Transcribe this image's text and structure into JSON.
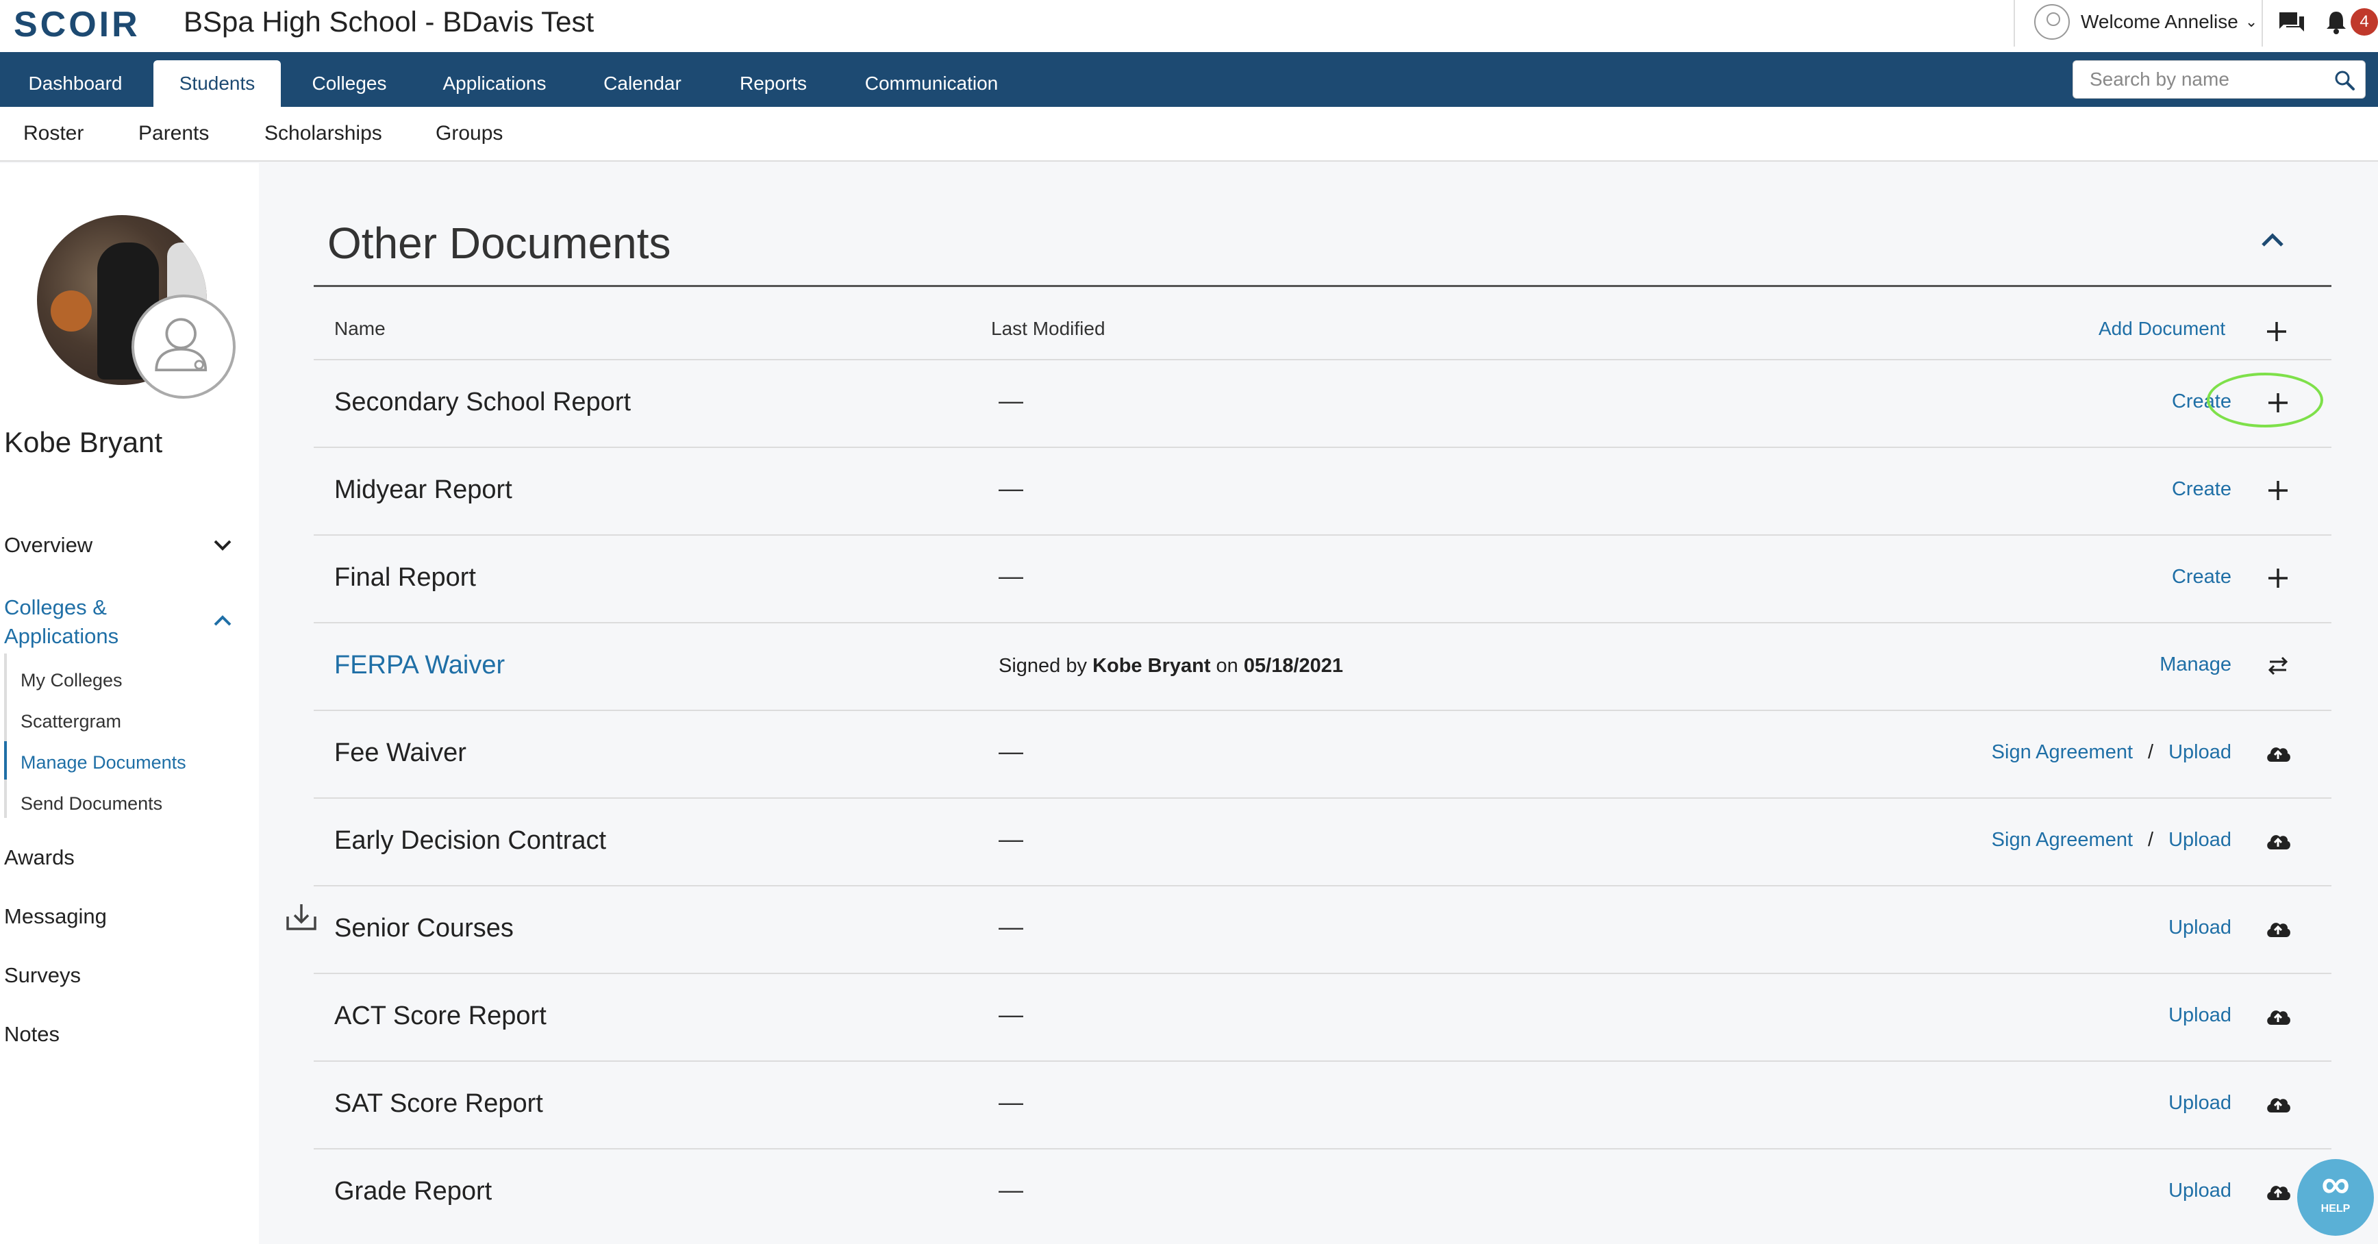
{
  "app": {
    "logo": "SCOIR",
    "school_title": "BSpa High School - BDavis Test",
    "welcome": "Welcome Annelise",
    "notification_count": "4"
  },
  "nav": {
    "tabs": [
      "Dashboard",
      "Students",
      "Colleges",
      "Applications",
      "Calendar",
      "Reports",
      "Communication"
    ],
    "active_tab": "Students",
    "search_placeholder": "Search by name"
  },
  "subnav": [
    "Roster",
    "Parents",
    "Scholarships",
    "Groups"
  ],
  "sidebar": {
    "student_name": "Kobe Bryant",
    "overview": "Overview",
    "colleges_applications": "Colleges & Applications",
    "sub_items": [
      "My Colleges",
      "Scattergram",
      "Manage Documents",
      "Send Documents"
    ],
    "active_sub_item": "Manage Documents",
    "items": [
      "Awards",
      "Messaging",
      "Surveys",
      "Notes"
    ]
  },
  "section": {
    "title": "Other Documents",
    "col_name": "Name",
    "col_modified": "Last Modified",
    "add_document": "Add Document"
  },
  "documents": [
    {
      "name": "Secondary School Report",
      "modified": "—",
      "actions": [
        "Create"
      ],
      "icon": "plus-icon",
      "highlighted": true
    },
    {
      "name": "Midyear Report",
      "modified": "—",
      "actions": [
        "Create"
      ],
      "icon": "plus-icon"
    },
    {
      "name": "Final Report",
      "modified": "—",
      "actions": [
        "Create"
      ],
      "icon": "plus-icon"
    },
    {
      "name": "FERPA Waiver",
      "link": true,
      "signed_prefix": "Signed by",
      "signed_by": "Kobe Bryant",
      "signed_on": "on",
      "signed_date": "05/18/2021",
      "actions": [
        "Manage"
      ],
      "icon": "swap-arrows-icon"
    },
    {
      "name": "Fee Waiver",
      "modified": "—",
      "actions": [
        "Sign Agreement",
        "Upload"
      ],
      "icon": "cloud-upload-icon",
      "download_icon": true
    },
    {
      "name": "Early Decision Contract",
      "modified": "—",
      "actions": [
        "Sign Agreement",
        "Upload"
      ],
      "icon": "cloud-upload-icon"
    },
    {
      "name": "Senior Courses",
      "modified": "—",
      "actions": [
        "Upload"
      ],
      "icon": "cloud-upload-icon"
    },
    {
      "name": "ACT Score Report",
      "modified": "—",
      "actions": [
        "Upload"
      ],
      "icon": "cloud-upload-icon"
    },
    {
      "name": "SAT Score Report",
      "modified": "—",
      "actions": [
        "Upload"
      ],
      "icon": "cloud-upload-icon"
    },
    {
      "name": "Grade Report",
      "modified": "—",
      "actions": [
        "Upload"
      ],
      "icon": "cloud-upload-icon"
    }
  ],
  "help": {
    "label": "HELP",
    "icon": "infinity-icon"
  },
  "colors": {
    "brand": "#1d4a72",
    "link": "#1f6fa6",
    "highlight": "#7ee04a",
    "badge": "#c0392b"
  }
}
